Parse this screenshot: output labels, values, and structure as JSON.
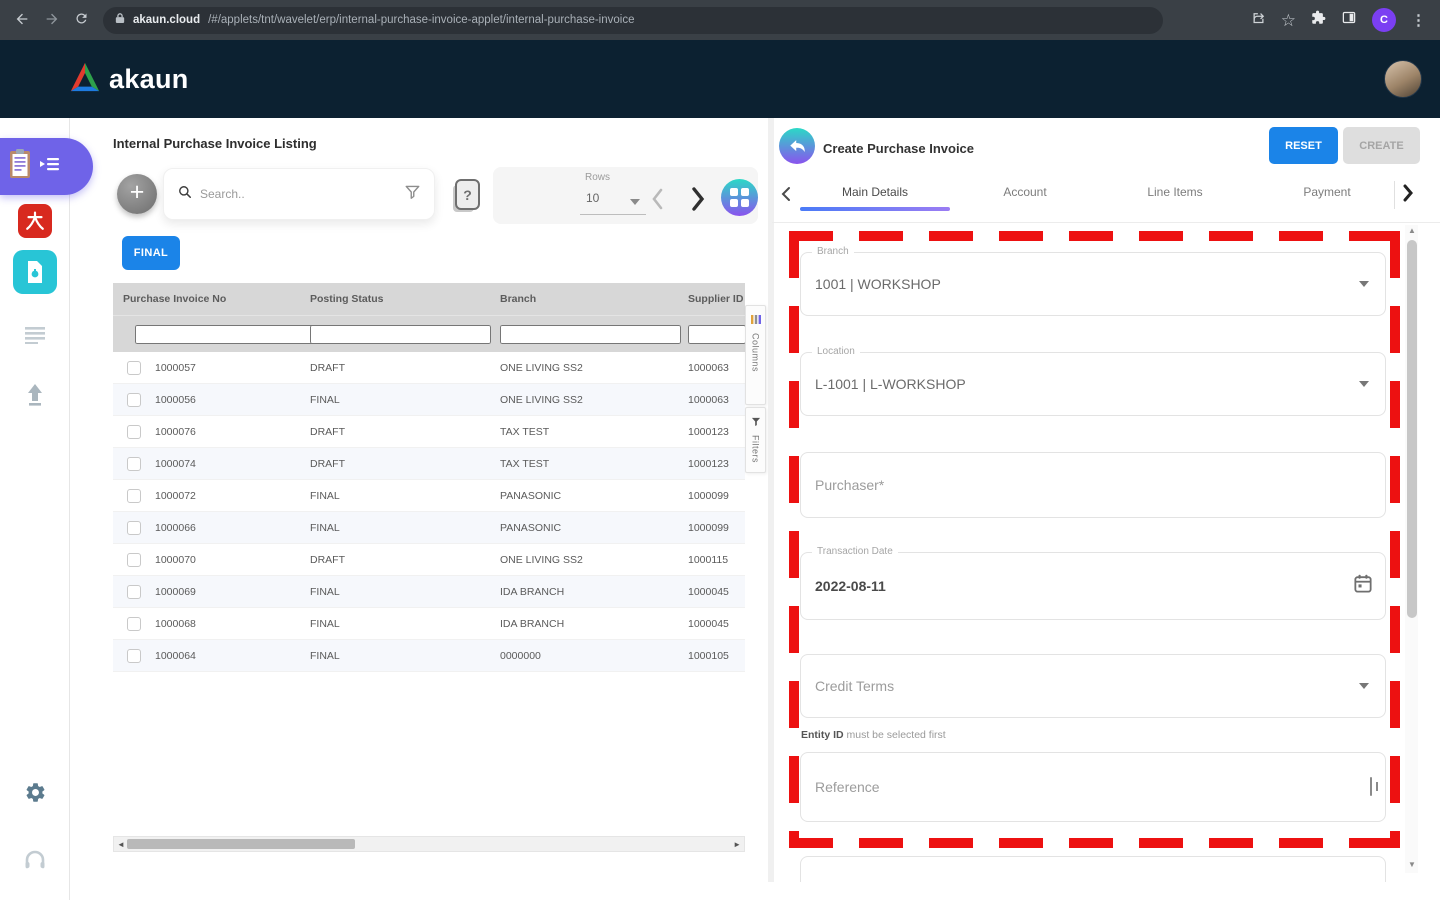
{
  "browser": {
    "url_domain": "akaun.cloud",
    "url_path": "/#/applets/tnt/wavelet/erp/internal-purchase-invoice-applet/internal-purchase-invoice",
    "avatar_letter": "C",
    "kebab_glyph": "⋮",
    "star_glyph": "☆"
  },
  "header": {
    "logo_text": "akaun"
  },
  "listing": {
    "title": "Internal Purchase Invoice Listing",
    "plus_glyph": "+",
    "search_placeholder": "Search..",
    "help_glyph": "?",
    "rows_label": "Rows",
    "rows_value": "10",
    "final_button": "FINAL",
    "side_tabs": [
      "Columns",
      "Filters"
    ],
    "table": {
      "columns": [
        "Purchase Invoice No",
        "Posting Status",
        "Branch",
        "Supplier ID"
      ],
      "rows": [
        [
          "1000057",
          "DRAFT",
          "ONE LIVING SS2",
          "1000063"
        ],
        [
          "1000056",
          "FINAL",
          "ONE LIVING SS2",
          "1000063"
        ],
        [
          "1000076",
          "DRAFT",
          "TAX TEST",
          "1000123"
        ],
        [
          "1000074",
          "DRAFT",
          "TAX TEST",
          "1000123"
        ],
        [
          "1000072",
          "FINAL",
          "PANASONIC",
          "1000099"
        ],
        [
          "1000066",
          "FINAL",
          "PANASONIC",
          "1000099"
        ],
        [
          "1000070",
          "DRAFT",
          "ONE LIVING SS2",
          "1000115"
        ],
        [
          "1000069",
          "FINAL",
          "IDA BRANCH",
          "1000045"
        ],
        [
          "1000068",
          "FINAL",
          "IDA BRANCH",
          "1000045"
        ],
        [
          "1000064",
          "FINAL",
          "0000000",
          "1000105"
        ]
      ]
    }
  },
  "form": {
    "title": "Create Purchase Invoice",
    "reset_button": "RESET",
    "create_button": "CREATE",
    "tabs": [
      "Main Details",
      "Account",
      "Line Items",
      "Payment"
    ],
    "active_tab": "Main Details",
    "fields": {
      "branch": {
        "label": "Branch",
        "value": "1001 | WORKSHOP"
      },
      "location": {
        "label": "Location",
        "value": "L-1001 | L-WORKSHOP"
      },
      "purchaser": {
        "placeholder": "Purchaser*"
      },
      "transaction_date": {
        "label": "Transaction Date",
        "value": "2022-08-11"
      },
      "credit_terms": {
        "placeholder": "Credit Terms"
      },
      "helper_bold": "Entity ID",
      "helper_rest": " must be selected first",
      "reference": {
        "placeholder": "Reference"
      }
    }
  },
  "colors": {
    "accent_blue": "#1b84e8",
    "header_navy": "#0c2131",
    "sidebar_active_purple": "#6f63e8",
    "gradient_teal": "#2bd9c6",
    "gradient_purple": "#8a53ee",
    "annotation_red": "#ed1111",
    "icon_red": "#d8291f",
    "icon_teal": "#28c5d6"
  }
}
